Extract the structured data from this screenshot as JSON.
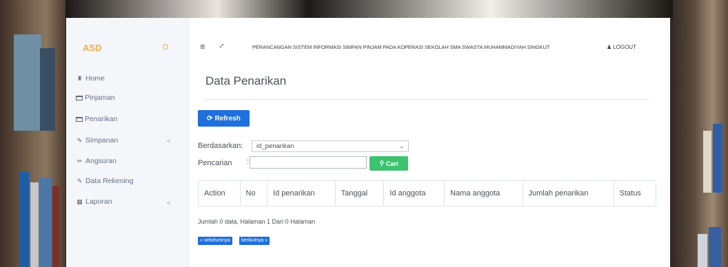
{
  "sidebar": {
    "brand": "ASD",
    "items": [
      {
        "label": "Home",
        "icon": "home-icon"
      },
      {
        "label": "Pinjaman",
        "icon": "card-icon"
      },
      {
        "label": "Penarikan",
        "icon": "card-icon"
      },
      {
        "label": "Simpanan",
        "icon": "edit-icon",
        "chevron": "<"
      },
      {
        "label": "Angsuran",
        "icon": "pencil-icon"
      },
      {
        "label": "Data Rekening",
        "icon": "edit-icon"
      },
      {
        "label": "Laporan",
        "icon": "calendar-icon",
        "chevron": "<"
      }
    ]
  },
  "topbar": {
    "menu_icon": "≡",
    "expand_icon": "⤢",
    "title": "PERANCANGAN SISTEM INFORMASI SIMPAN PINJAM PADA KOPERASI SEKOLAH SMA SWASTA MUHAMMADIYAH SINGKUT",
    "logout": "LOGOUT"
  },
  "page": {
    "title": "Data Penarikan",
    "refresh_label": "Refresh",
    "filter_label": "Berdasarkan:",
    "filter_value": "id_penarikan",
    "search_label": "Pencarian",
    "search_colon": ":",
    "search_value": "",
    "search_button": "Cari"
  },
  "table": {
    "columns": [
      "Action",
      "No",
      "Id penarikan",
      "Tanggal",
      "Id anggota",
      "Nama anggota",
      "Jumlah penarikan",
      "Status"
    ]
  },
  "footer": {
    "summary": "Jumlah 0 data, Halaman 1 Dari 0 Halaman",
    "prev_label": "« sebelumnya",
    "next_label": "berikutnya »"
  }
}
